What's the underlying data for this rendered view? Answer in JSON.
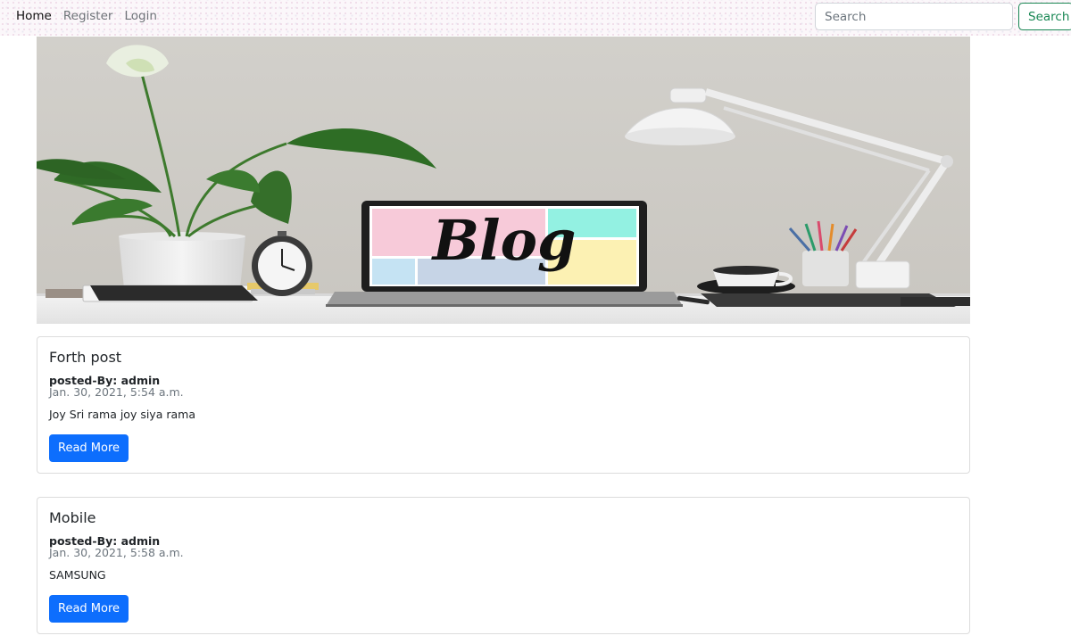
{
  "nav": {
    "links": [
      {
        "label": "Home"
      },
      {
        "label": "Register"
      },
      {
        "label": "Login"
      }
    ],
    "search_placeholder": "Search",
    "search_button": "Search"
  },
  "hero": {
    "screen_text": "Blog"
  },
  "posts": [
    {
      "title": "Forth post",
      "author": "posted-By: admin",
      "date": "Jan. 30, 2021, 5:54 a.m.",
      "body": "Joy Sri rama joy siya rama",
      "button": "Read More"
    },
    {
      "title": "Mobile",
      "author": "posted-By: admin",
      "date": "Jan. 30, 2021, 5:58 a.m.",
      "body": "SAMSUNG",
      "button": "Read More"
    }
  ],
  "colors": {
    "primary": "#0d6efd",
    "success": "#198754",
    "muted": "#6c757d"
  }
}
